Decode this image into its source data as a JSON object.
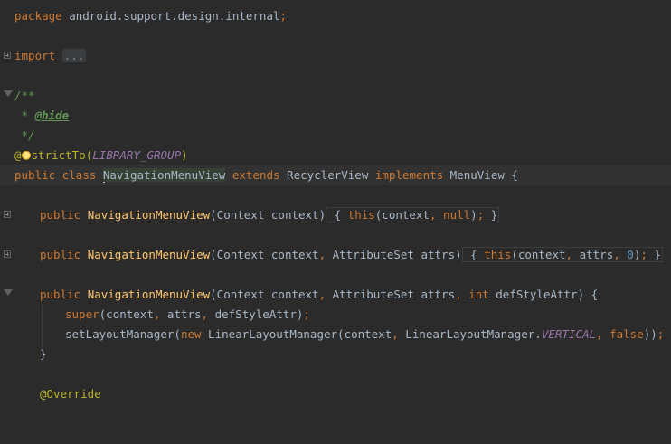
{
  "code": {
    "package_line": {
      "kw": "package",
      "name": " android.support.design.internal",
      "semi": ";"
    },
    "import_line": {
      "kw": "import",
      "folded": "..."
    },
    "doc_open": "/**",
    "doc_star": " * ",
    "doc_tag": "@hide",
    "doc_close": " */",
    "restrict_line": {
      "at": "@",
      "rest": "strictTo(",
      "const": "LIBRARY_GROUP",
      "close": ")"
    },
    "class_line": {
      "kw1": "public class ",
      "name": "NavigationMenuView",
      "kw2": " extends ",
      "super": "RecyclerView",
      "kw3": " implements ",
      "iface": "MenuView",
      "brace": " {"
    },
    "ctor1": {
      "kw": "public ",
      "name": "NavigationMenuView",
      "params": "(Context context)",
      "open": " { ",
      "this_kw": "this",
      "args_a": "(context",
      "comma": ",",
      "null_kw": " null",
      "args_b": ")",
      "semi": ";",
      "close": " }"
    },
    "ctor2": {
      "kw": "public ",
      "name": "NavigationMenuView",
      "p1": "(Context context",
      "c1": ",",
      "p2": " AttributeSet attrs)",
      "open": " { ",
      "this_kw": "this",
      "a1": "(context",
      "c2": ",",
      "a2": " attrs",
      "c3": ",",
      "num": " 0",
      "a3": ")",
      "semi": ";",
      "close": " }"
    },
    "ctor3": {
      "kw": "public ",
      "name": "NavigationMenuView",
      "p1": "(Context context",
      "c1": ",",
      "p2": " AttributeSet attrs",
      "c2": ",",
      "int_kw": " int",
      "p3": " defStyleAttr) {"
    },
    "super_line": {
      "kw": "super",
      "a1": "(context",
      "c1": ",",
      "a2": " attrs",
      "c2": ",",
      "a3": " defStyleAttr)",
      "semi": ";"
    },
    "layout_line": {
      "call": "setLayoutManager(",
      "new_kw": "new",
      "cls": " LinearLayoutManager(context",
      "c1": ",",
      "ref": " LinearLayoutManager.",
      "const": "VERTICAL",
      "c2": ",",
      "false_kw": " false",
      "end": "))",
      "semi": ";"
    },
    "close_brace": "}",
    "override": "@Override"
  },
  "colors": {
    "background": "#2b2b2b",
    "keyword": "#cc7832",
    "method": "#ffc66d",
    "doc_comment": "#629755",
    "annotation": "#bbb529",
    "constant": "#9876aa",
    "number": "#6897bb",
    "text": "#a9b7c6"
  }
}
